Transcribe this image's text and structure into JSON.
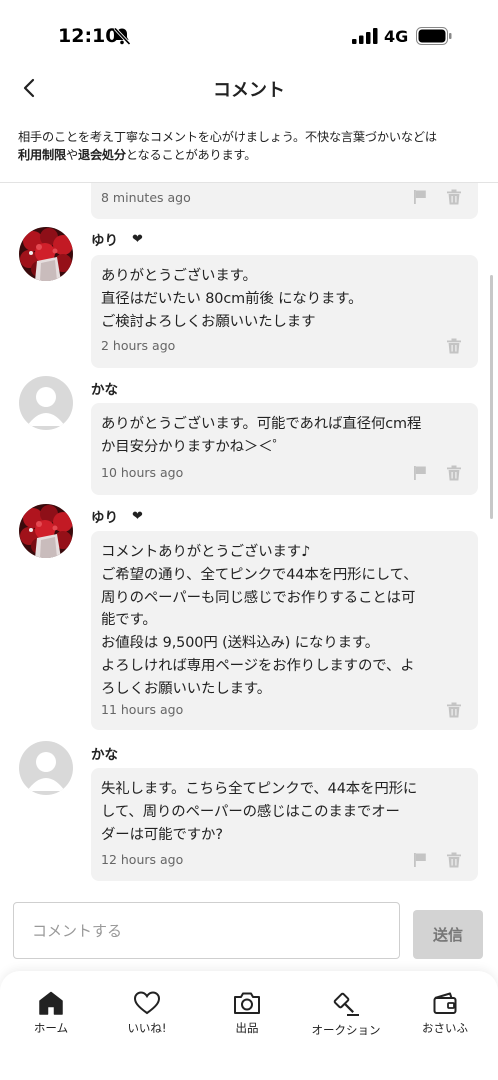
{
  "status_bar": {
    "time": "12:10",
    "network": "4G"
  },
  "header": {
    "title": "コメント"
  },
  "notice": {
    "line1": "相手のことを考え丁寧なコメントを心がけましょう。不快な言葉づかいなどは",
    "emphasis1": "利用制限",
    "connector": "や",
    "emphasis2": "退会処分",
    "suffix": "となることがあります。"
  },
  "comments": [
    {
      "time": "8 minutes ago"
    },
    {
      "user": "ゆり",
      "badge": "❤",
      "text": "ありがとうございます。\n直径はだいたい 80cm前後 になります。\nご検討よろしくお願いいたします",
      "time": "2 hours ago"
    },
    {
      "user": "かな",
      "text": "ありがとうございます。可能であれば直径何cm程\nか目安分かりますかね＞＜゜",
      "time": "10 hours ago"
    },
    {
      "user": "ゆり",
      "badge": "❤",
      "text": "コメントありがとうございます♪\nご希望の通り、全てピンクで44本を円形にして、\n周りのペーパーも同じ感じでお作りすることは可\n能です。\nお値段は 9,500円 (送料込み) になります。\nよろしければ専用ページをお作りしますので、よ\nろしくお願いいたします。",
      "time": "11 hours ago"
    },
    {
      "user": "かな",
      "text": "失礼します。こちら全てピンクで、44本を円形に\nして、周りのペーパーの感じはこのままでオー\nダーは可能ですか?",
      "time": "12 hours ago"
    }
  ],
  "input": {
    "placeholder": "コメントする",
    "send_label": "送信"
  },
  "tabs": [
    {
      "label": "ホーム",
      "icon": "home-icon"
    },
    {
      "label": "いいね!",
      "icon": "heart-icon"
    },
    {
      "label": "出品",
      "icon": "camera-icon"
    },
    {
      "label": "オークション",
      "icon": "gavel-icon"
    },
    {
      "label": "おさいふ",
      "icon": "wallet-icon"
    }
  ],
  "colors": {
    "bubble": "#f2f2f2",
    "send_disabled": "#d3d3d3",
    "text": "#222222"
  }
}
